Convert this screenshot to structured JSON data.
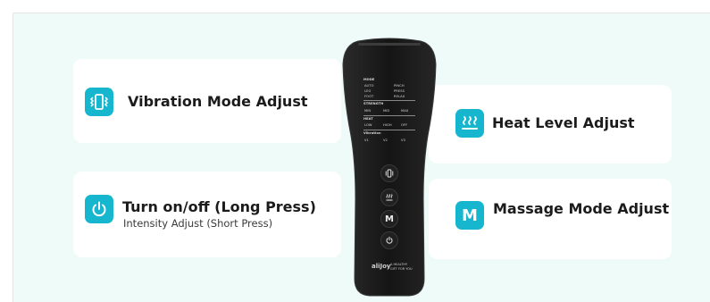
{
  "features": {
    "vibration": {
      "label": "Vibration Mode Adjust",
      "icon": "vibration-icon"
    },
    "heat": {
      "label": "Heat Level Adjust",
      "icon": "heat-waves-icon"
    },
    "power": {
      "label": "Turn on/off (Long Press)",
      "sublabel": "Intensity Adjust (Short Press)",
      "icon": "power-icon"
    },
    "massage": {
      "label": "Massage Mode Adjust",
      "icon": "m-letter-icon",
      "icon_letter": "M"
    }
  },
  "remote": {
    "screen": {
      "mode_heading": "MODE",
      "mode_items": [
        "AUTO",
        "PINCH",
        "LEG",
        "PRESS",
        "FOOT",
        "RELAX"
      ],
      "strength_heading": "STRENGTH",
      "strength_items": [
        "MIN",
        "MID",
        "MAX"
      ],
      "heat_heading": "HEAT",
      "heat_items": [
        "LOW",
        "HIGH",
        "OFF"
      ],
      "vibration_heading": "Vibration",
      "vibration_items": [
        "V1",
        "V2",
        "V3"
      ]
    },
    "buttons": {
      "massage_letter": "M"
    },
    "brand": {
      "name": "aliJoy",
      "tagline_1": "A HEALTHY",
      "tagline_2": "GIFT FOR YOU"
    }
  },
  "colors": {
    "accent": "#16b6cf",
    "panel_bg": "#eefbf9",
    "card_bg": "#ffffff",
    "remote_body": "#1c1c1c"
  }
}
